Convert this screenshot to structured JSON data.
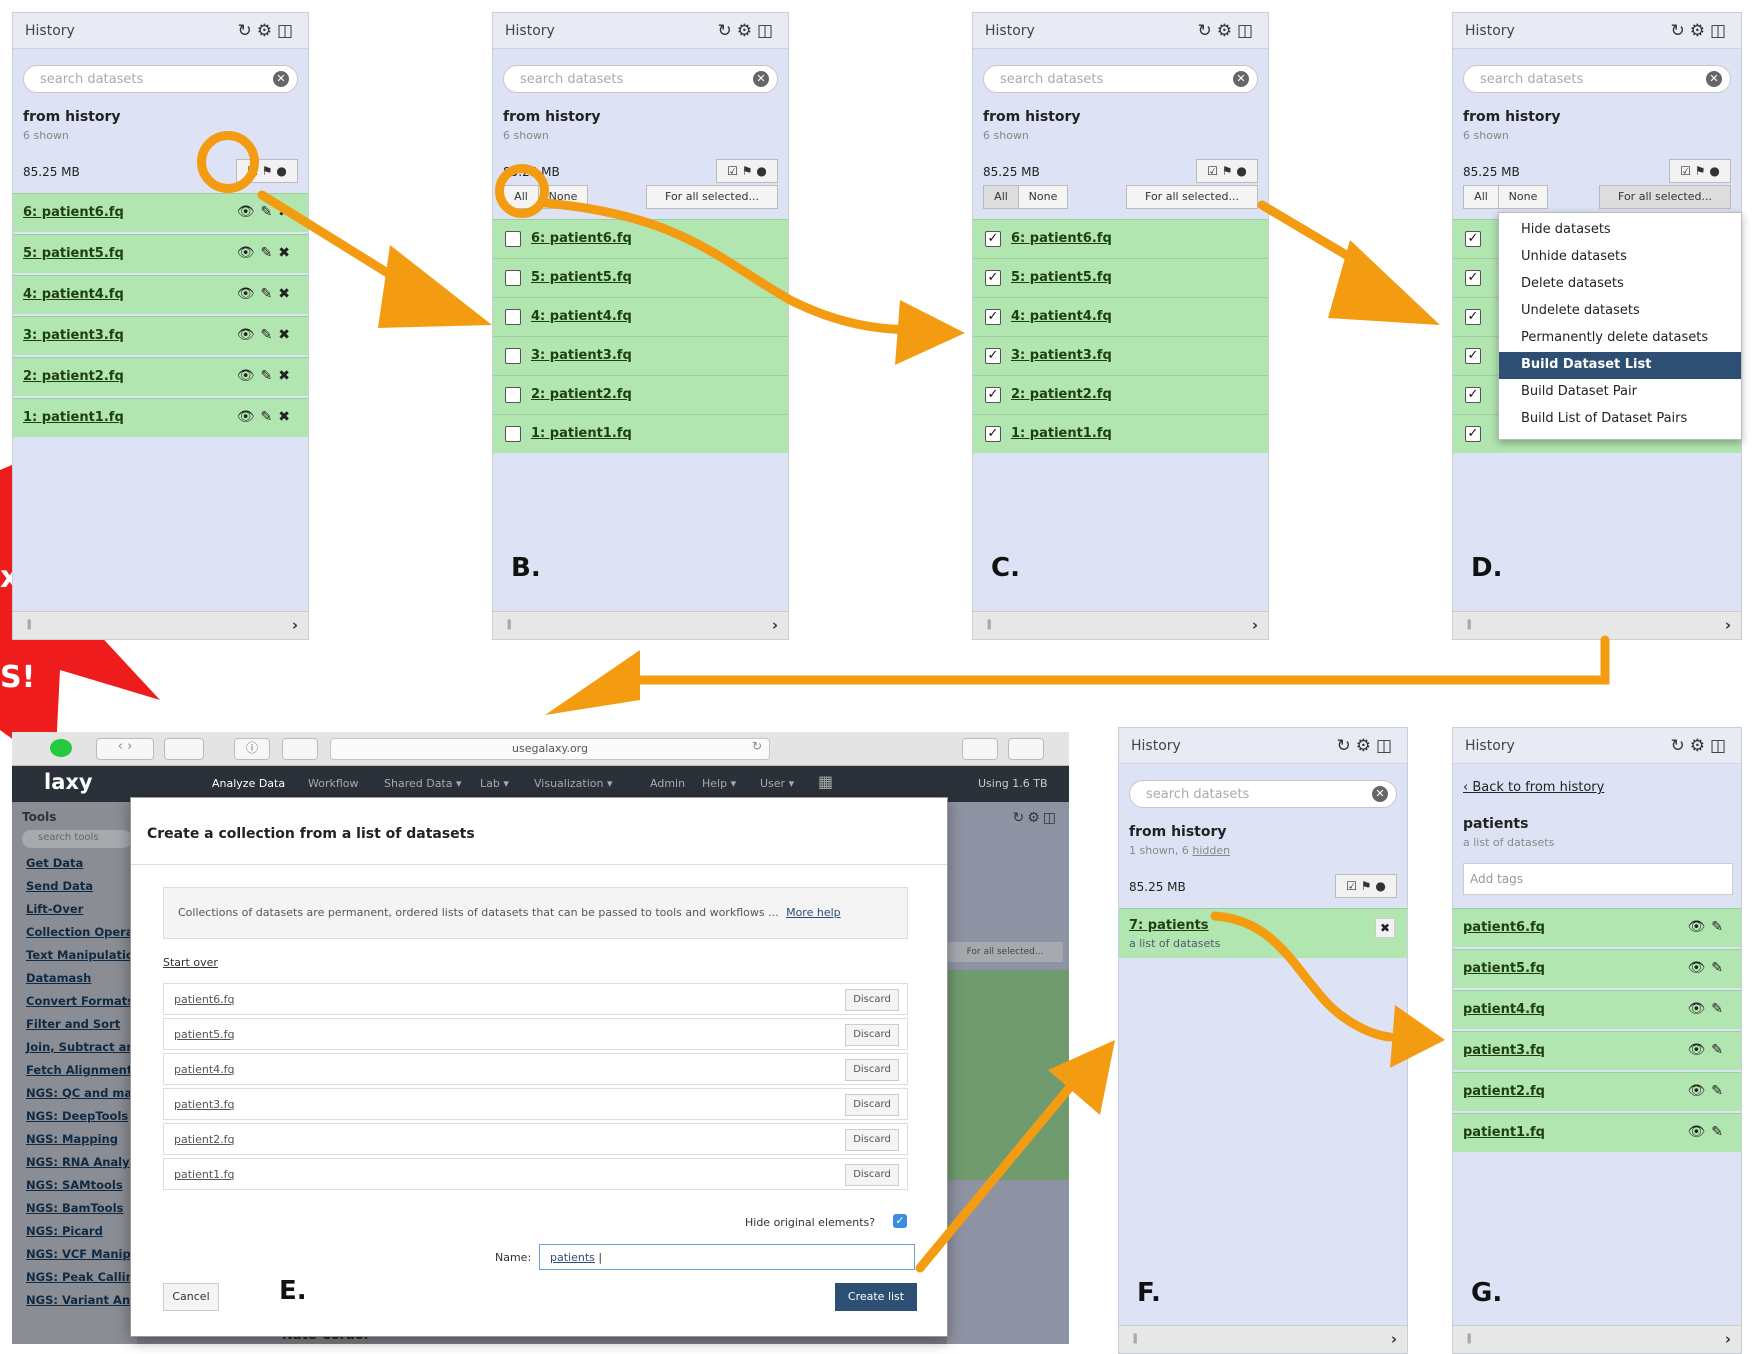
{
  "history": {
    "title": "History",
    "search_placeholder": "search datasets",
    "name": "from history",
    "shown": "6 shown",
    "size": "85.25 MB"
  },
  "datasets": [
    "6: patient6.fq",
    "5: patient5.fq",
    "4: patient4.fq",
    "3: patient3.fq",
    "2: patient2.fq",
    "1: patient1.fq"
  ],
  "select_buttons": {
    "all": "All",
    "none": "None",
    "for_all": "For all selected..."
  },
  "menu_items": [
    "Hide datasets",
    "Unhide datasets",
    "Delete datasets",
    "Undelete datasets",
    "Permanently delete datasets",
    "Build Dataset List",
    "Build Dataset Pair",
    "Build List of Dataset Pairs"
  ],
  "menu_selected": "Build Dataset List",
  "letters": {
    "b": "B.",
    "c": "C.",
    "d": "D.",
    "e": "E.",
    "f": "F.",
    "g": "G."
  },
  "starburst": {
    "line1": "x",
    "line2": "S!"
  },
  "browser": {
    "url": "usegalaxy.org",
    "brand": "laxy",
    "nav": [
      "Analyze Data",
      "Workflow",
      "Shared Data ▾",
      "Lab ▾",
      "Visualization ▾",
      "Admin",
      "Help ▾",
      "User ▾"
    ],
    "usage": "Using 1.6 TB",
    "tools_title": "Tools",
    "tools_search": "search tools",
    "tools": [
      "Get Data",
      "Send Data",
      "Lift-Over",
      "Collection Opera",
      "Text Manipulatio",
      "Datamash",
      "Convert Formats",
      "Filter and Sort",
      "Join, Subtract an",
      "Fetch Alignment",
      "NGS: QC and ma",
      "NGS: DeepTools",
      "NGS: Mapping",
      "NGS: RNA Analy",
      "NGS: SAMtools",
      "NGS: BamTools",
      "NGS: Picard",
      "NGS: VCF Manip",
      "NGS: Peak Callin",
      "NGS: Variant Ana"
    ],
    "user_name": "Nate Coraor",
    "behind_for_all": "For all selected..."
  },
  "modal": {
    "title": "Create a collection from a list of datasets",
    "help": "Collections of datasets are permanent, ordered lists of datasets that can be passed to tools and workflows ...",
    "more_help": "More help",
    "start_over": "Start over",
    "items": [
      "patient6.fq",
      "patient5.fq",
      "patient4.fq",
      "patient3.fq",
      "patient2.fq",
      "patient1.fq"
    ],
    "discard": "Discard",
    "hide_original": "Hide original elements?",
    "name_label": "Name:",
    "name_value": "patients",
    "cancel": "Cancel",
    "create": "Create list"
  },
  "panel_f": {
    "shown": "1 shown, 6 ",
    "hidden": "hidden",
    "collection_name": "7: patients",
    "collection_desc": "a list of datasets"
  },
  "panel_g": {
    "back": "‹ Back to from history",
    "name": "patients",
    "desc": "a list of datasets",
    "tags_placeholder": "Add tags",
    "items": [
      "patient6.fq",
      "patient5.fq",
      "patient4.fq",
      "patient3.fq",
      "patient2.fq",
      "patient1.fq"
    ]
  },
  "colors": {
    "arrow": "#f39c12",
    "dataset_ok": "#b2e6b0",
    "panel": "#dde3f4",
    "menu_selected": "#2c4f73",
    "starburst": "#ee1c1c"
  }
}
